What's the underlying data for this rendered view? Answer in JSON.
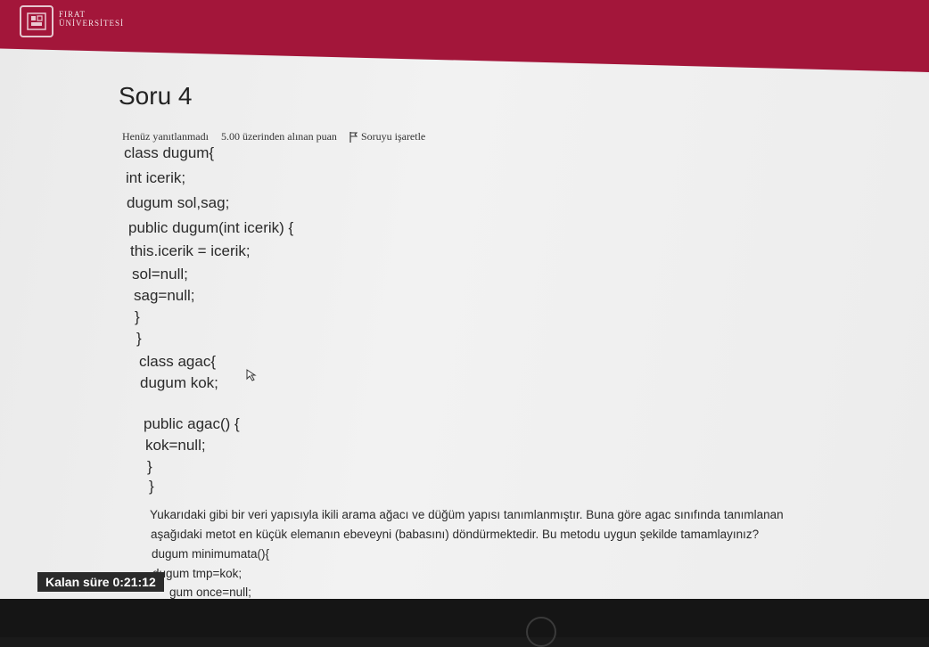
{
  "header": {
    "logo_line1": "FIRAT",
    "logo_line2": "ÜNİVERSİTESİ",
    "brand_color": "#a3163a"
  },
  "question": {
    "title": "Soru 4",
    "status": "Henüz yanıtlanmadı",
    "points": "5.00 üzerinden alınan puan",
    "flag_label": "Soruyu işaretle"
  },
  "code": [
    "class dugum{",
    "int icerik;",
    "dugum sol,sag;",
    "public dugum(int icerik) {",
    "this.icerik = icerik;",
    "sol=null;",
    "sag=null;",
    "}",
    "}",
    "class agac{",
    "dugum kok;",
    "public agac() {",
    "kok=null;",
    "}",
    "}"
  ],
  "text": {
    "paragraph_line1": "Yukarıdaki gibi bir veri yapısıyla ikili arama ağacı ve düğüm yapısı tanımlanmıştır. Buna göre agac sınıfında tanımlanan",
    "paragraph_line2": "aşağıdaki metot en küçük elemanın ebeveyni (babasını) döndürmektedir. Bu metodu uygun şekilde tamamlayınız?",
    "method_line1": "dugum minimumata(){",
    "method_line2": "dugum tmp=kok;",
    "method_line3": "gum once=null;"
  },
  "timer": {
    "label": "Kalan süre 0:21:12"
  }
}
